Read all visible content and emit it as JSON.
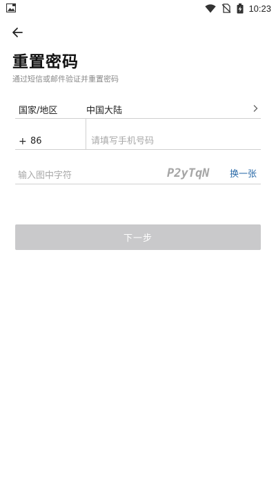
{
  "status_bar": {
    "time": "10:23",
    "icons": [
      "photo-icon",
      "wifi-icon",
      "no-sim-icon",
      "battery-charging-icon"
    ]
  },
  "header": {
    "back_icon": "arrow-left-icon",
    "title": "重置密码",
    "subtitle": "通过短信或邮件验证并重置密码"
  },
  "form": {
    "country": {
      "label": "国家/地区",
      "value": "中国大陆",
      "chevron_icon": "chevron-right-icon"
    },
    "phone": {
      "plus": "+",
      "code": "86",
      "placeholder": "请填写手机号码",
      "value": ""
    },
    "captcha": {
      "placeholder": "输入图中字符",
      "value": "",
      "image_text": "P2yTqN",
      "refresh_label": "换一张"
    }
  },
  "actions": {
    "next_label": "下一步"
  },
  "colors": {
    "accent_link": "#2a6aa8",
    "button_disabled": "#c9c9cb",
    "divider": "#cfcfcf",
    "placeholder": "#a8a8a8"
  }
}
